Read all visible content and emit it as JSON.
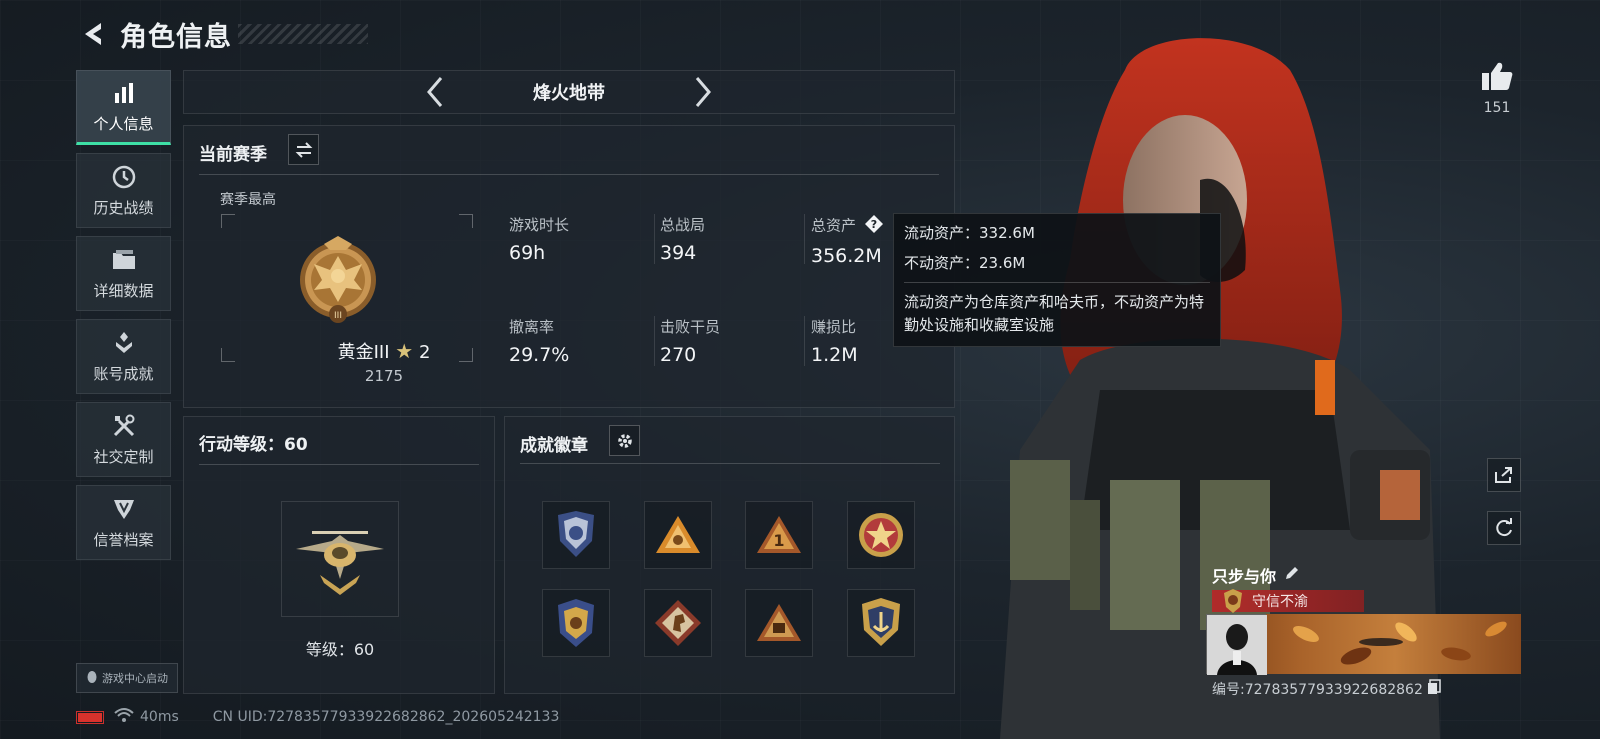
{
  "header": {
    "title": "角色信息"
  },
  "sidebar": {
    "items": [
      {
        "label": "个人信息",
        "icon": "bar-chart-icon",
        "active": true
      },
      {
        "label": "历史战绩",
        "icon": "clock-icon"
      },
      {
        "label": "详细数据",
        "icon": "folder-icon"
      },
      {
        "label": "账号成就",
        "icon": "achievement-icon"
      },
      {
        "label": "社交定制",
        "icon": "tools-icon"
      },
      {
        "label": "信誉档案",
        "icon": "shield-icon"
      }
    ],
    "launch_label": "游戏中心启动"
  },
  "mode_selector": {
    "name": "烽火地带"
  },
  "season": {
    "title": "当前赛季",
    "best_label": "赛季最高",
    "rank_name": "黄金III",
    "rank_stars": "2",
    "rank_score": "2175",
    "stats": [
      {
        "label": "游戏时长",
        "value": "69h"
      },
      {
        "label": "总战局",
        "value": "394"
      },
      {
        "label": "总资产",
        "value": "356.2M"
      },
      {
        "label": "撤离率",
        "value": "29.7%"
      },
      {
        "label": "击败干员",
        "value": "270"
      },
      {
        "label": "赚损比",
        "value": "1.2M"
      }
    ]
  },
  "tooltip": {
    "liquid": "流动资产：332.6M",
    "fixed": "不动资产：23.6M",
    "description": "流动资产为仓库资产和哈夫币，不动资产为特勤处设施和收藏室设施"
  },
  "level": {
    "title": "行动等级：60",
    "level_text": "等级：60"
  },
  "badges": {
    "title": "成就徽章",
    "items": [
      "blue-shield-badge",
      "orange-triangle-badge",
      "number-one-badge",
      "star-medal-badge",
      "eagle-crest-badge",
      "horse-diamond-badge",
      "skull-triangle-badge",
      "anchor-crest-badge"
    ]
  },
  "status": {
    "ping": "40ms",
    "uid": "CN UID:7278357793392268286​2_202605242133"
  },
  "player": {
    "likes": "151",
    "name": "只步与你",
    "title_tag": "守信不渝",
    "id": "编号:72783577933922682862"
  },
  "colors": {
    "accent": "#3ee0a6",
    "tag_red": "#b42828",
    "battery": "#d8322c"
  }
}
